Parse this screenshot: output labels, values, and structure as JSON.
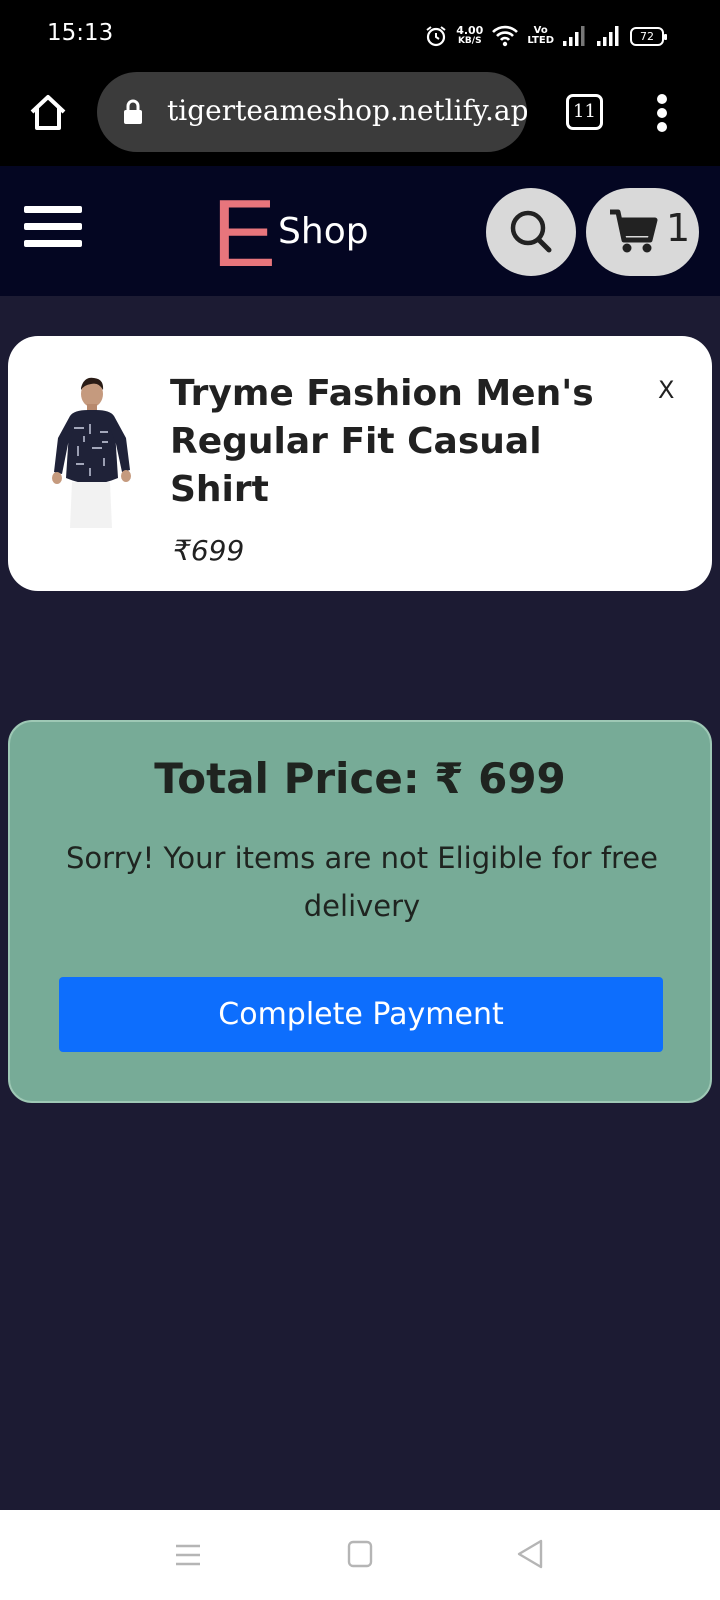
{
  "status_bar": {
    "time": "15:13",
    "net_speed_value": "4.00",
    "net_speed_unit": "KB/S",
    "volte_top": "Vo",
    "volte_bottom": "LTED",
    "battery": "72"
  },
  "browser": {
    "url": "tigerteameshop.netlify.app/",
    "tab_count": "11"
  },
  "navbar": {
    "logo_letter": "E",
    "logo_text": "Shop",
    "cart_count": "1",
    "logo_color": "#e8757c"
  },
  "cart_item": {
    "title": "Tryme Fashion Men's Regular Fit Casual Shirt",
    "price": "₹699",
    "remove_label": "X"
  },
  "summary": {
    "total_price": "Total Price: ₹ 699",
    "delivery_message": "Sorry! Your items are not Eligible for free delivery",
    "pay_button_label": "Complete Payment",
    "pay_button_color": "#0d6efd",
    "box_color": "#77ab97"
  }
}
